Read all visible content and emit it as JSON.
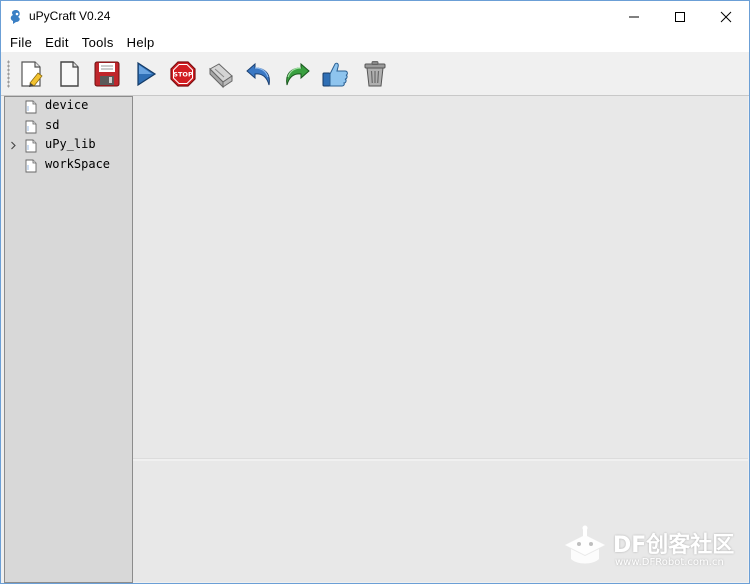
{
  "window": {
    "title": "uPyCraft V0.24",
    "controls": [
      "minimize-icon",
      "maximize-icon",
      "close-icon"
    ]
  },
  "menubar": {
    "items": [
      {
        "label": "File"
      },
      {
        "label": "Edit"
      },
      {
        "label": "Tools"
      },
      {
        "label": "Help"
      }
    ]
  },
  "toolbar": {
    "buttons": [
      {
        "icon": "new-file-icon"
      },
      {
        "icon": "open-file-icon"
      },
      {
        "icon": "save-icon"
      },
      {
        "icon": "run-icon"
      },
      {
        "icon": "stop-icon"
      },
      {
        "icon": "connect-icon"
      },
      {
        "icon": "undo-icon"
      },
      {
        "icon": "redo-icon"
      },
      {
        "icon": "syntax-check-icon"
      },
      {
        "icon": "clear-trash-icon"
      }
    ],
    "stop_text": "STOP"
  },
  "file_tree": {
    "items": [
      {
        "label": "device",
        "expandable": false
      },
      {
        "label": "sd",
        "expandable": false
      },
      {
        "label": "uPy_lib",
        "expandable": true
      },
      {
        "label": "workSpace",
        "expandable": false
      }
    ]
  },
  "watermark": {
    "brand": "DF创客社区",
    "url": "www.DFRobot.com.cn"
  },
  "colors": {
    "window_border": "#6b9fd6",
    "sidebar_bg": "#d8d8d8",
    "editor_bg": "#e8e8e8",
    "toolbar_bg": "#f0f0f0"
  }
}
